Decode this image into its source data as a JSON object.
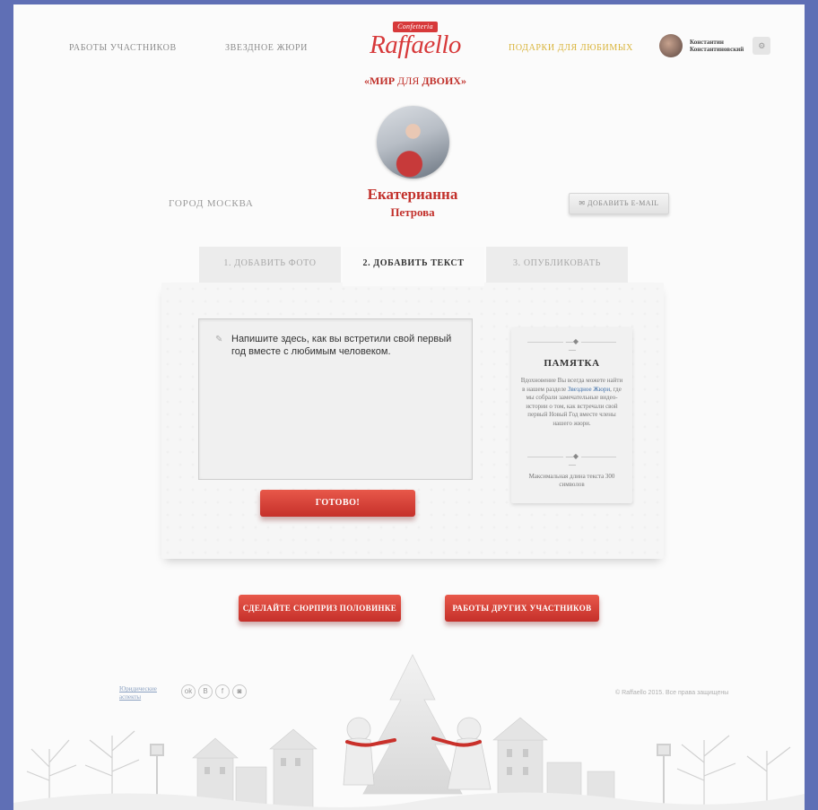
{
  "header": {
    "nav_works": "РАБОТЫ УЧАСТНИКОВ",
    "nav_jury": "ЗВЕЗДНОЕ ЖЮРИ",
    "nav_gifts": "ПОДАРКИ ДЛЯ ЛЮБИМЫХ",
    "logo_badge": "Confetteria",
    "logo_word": "Raffaello",
    "slogan_open": "«МИР",
    "slogan_mid": " ДЛЯ ",
    "slogan_close": "ДВОИХ»",
    "user_first": "Константин",
    "user_last": "Константиновский"
  },
  "profile": {
    "city": "ГОРОД МОСКВА",
    "first_name": "Екатерианна",
    "last_name": "Петрова",
    "add_email_label": "ДОБАВИТЬ E-MAIL"
  },
  "tabs": [
    {
      "label": "1.  ДОБАВИТЬ ФОТО",
      "active": false
    },
    {
      "label": "2.  ДОБАВИТЬ ТЕКСТ",
      "active": true
    },
    {
      "label": "3.  ОПУБЛИКОВАТЬ",
      "active": false
    }
  ],
  "editor": {
    "placeholder": "Напишите здесь, как вы встретили свой первый год вместе с любимым человеком.",
    "done_label": "ГОТОВО!"
  },
  "memo": {
    "title": "ПАМЯТКА",
    "text_before": "Вдохновение Вы всегда можете найти в нашем разделе ",
    "link": "Звездное Жюри",
    "text_after": ", где мы собрали замечательные видео-истории о том, как встречали свой первый Новый Год вместе члены нашего жюри.",
    "max_length": "Максимальная длина текста 300 символов"
  },
  "actions": {
    "surprise_label": "СДЕЛАЙТЕ СЮРПРИЗ ПОЛОВИНКЕ",
    "others_label": "РАБОТЫ ДРУГИХ УЧАСТНИКОВ"
  },
  "footer": {
    "legal_line1": "Юридические",
    "legal_line2": "аспекты",
    "socials": [
      "ok",
      "В",
      "f",
      "◙"
    ],
    "copyright": "© Raffaello 2015. Все права защищены"
  },
  "colors": {
    "accent_red": "#c5302a",
    "gold": "#d9b43a",
    "background_frame": "#5f6fb5"
  }
}
